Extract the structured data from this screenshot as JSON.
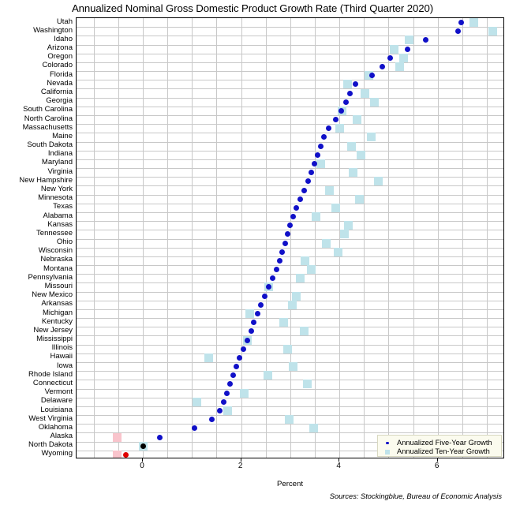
{
  "chart_data": {
    "type": "scatter",
    "title": "Annualized Nominal Gross Domestic Product Growth Rate (Third Quarter 2020)",
    "xlabel": "Percent",
    "ylabel": "",
    "xlim": [
      -1.35,
      7.37
    ],
    "xticks": [
      0,
      2,
      4,
      6
    ],
    "xticklabels": [
      "0",
      "2",
      "4",
      "6"
    ],
    "grid": true,
    "legend_position": "bottom-right",
    "source_note": "Sources: Stockingblue, Bureau of Economic Analysis",
    "series": [
      {
        "name": "Annualized Five-Year Growth",
        "marker": "circle",
        "color_positive": "#1010c8",
        "color_zero": "#000000",
        "color_negative": "#e00000",
        "values": [
          6.48,
          6.42,
          5.75,
          5.38,
          5.03,
          4.87,
          4.67,
          4.32,
          4.22,
          4.14,
          4.04,
          3.92,
          3.78,
          3.68,
          3.62,
          3.55,
          3.49,
          3.42,
          3.36,
          3.28,
          3.21,
          3.13,
          3.06,
          3.0,
          2.95,
          2.9,
          2.84,
          2.78,
          2.72,
          2.64,
          2.56,
          2.48,
          2.4,
          2.33,
          2.26,
          2.2,
          2.13,
          2.05,
          1.97,
          1.9,
          1.83,
          1.77,
          1.71,
          1.64,
          1.57,
          1.4,
          1.05,
          0.35,
          0.0,
          -0.35
        ]
      },
      {
        "name": "Annualized Ten-Year Growth",
        "marker": "square",
        "color_positive": "#bfe3ea",
        "color_negative": "#f9c4cc",
        "values": [
          6.74,
          7.12,
          5.42,
          5.12,
          5.3,
          5.22,
          4.6,
          4.16,
          4.52,
          4.72,
          4.06,
          4.36,
          4.0,
          4.64,
          4.24,
          4.44,
          3.62,
          4.28,
          4.8,
          3.8,
          4.4,
          3.92,
          3.52,
          4.18,
          4.1,
          3.74,
          3.98,
          3.3,
          3.42,
          3.2,
          2.56,
          3.12,
          3.04,
          2.18,
          2.86,
          3.28,
          2.12,
          2.94,
          1.34,
          3.06,
          2.54,
          3.34,
          2.06,
          1.1,
          1.72,
          2.98,
          3.48,
          -0.52,
          0.0,
          -0.52
        ]
      }
    ],
    "categories": [
      "Utah",
      "Washington",
      "Idaho",
      "Arizona",
      "Oregon",
      "Colorado",
      "Florida",
      "Nevada",
      "California",
      "Georgia",
      "South Carolina",
      "North Carolina",
      "Massachusetts",
      "Maine",
      "South Dakota",
      "Indiana",
      "Maryland",
      "Virginia",
      "New Hampshire",
      "New York",
      "Minnesota",
      "Texas",
      "Alabama",
      "Kansas",
      "Tennessee",
      "Ohio",
      "Wisconsin",
      "Nebraska",
      "Montana",
      "Pennsylvania",
      "Missouri",
      "New Mexico",
      "Arkansas",
      "Michigan",
      "Kentucky",
      "New Jersey",
      "Mississippi",
      "Illinois",
      "Hawaii",
      "Iowa",
      "Rhode Island",
      "Connecticut",
      "Vermont",
      "Delaware",
      "Louisiana",
      "West Virginia",
      "Oklahoma",
      "Alaska",
      "North Dakota",
      "Wyoming"
    ]
  }
}
